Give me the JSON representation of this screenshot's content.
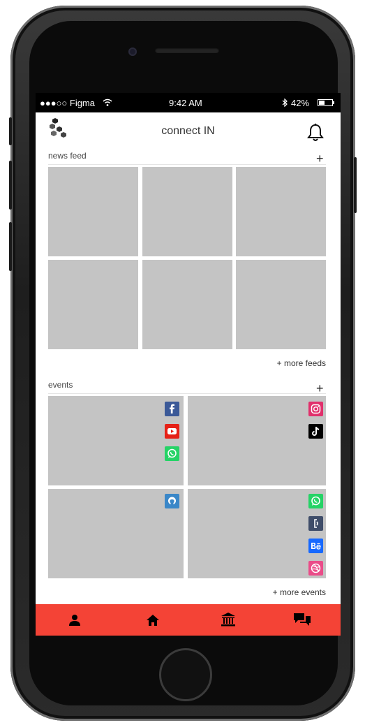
{
  "status_bar": {
    "carrier": "●●●○○ Figma",
    "time": "9:42 AM",
    "battery": "42%",
    "battery_level": 0.42
  },
  "header": {
    "title": "connect IN",
    "logo_icon": "hexagon-cluster-logo",
    "bell_icon": "bell-icon"
  },
  "news_feed": {
    "label": "news feed",
    "add_symbol": "+",
    "more_link": "+  more feeds",
    "tile_count": 6
  },
  "events": {
    "label": "events",
    "add_symbol": "+",
    "more_link": "+  more events",
    "cards": [
      {
        "icons": [
          "facebook-icon",
          "youtube-icon",
          "whatsapp-icon"
        ]
      },
      {
        "icons": [
          "instagram-icon",
          "tiktok-icon"
        ]
      },
      {
        "icons": [
          "github-icon"
        ]
      },
      {
        "icons": [
          "whatsapp-icon",
          "google-scholar-icon",
          "behance-icon",
          "dribbble-icon"
        ]
      }
    ]
  },
  "tab_bar": {
    "items": [
      "profile-icon",
      "home-icon",
      "institution-icon",
      "chat-icon"
    ]
  },
  "colors": {
    "tab_bar": "#f44336",
    "tile": "#c4c4c4",
    "facebook": "#3b5998",
    "youtube": "#e62117",
    "whatsapp": "#25d366",
    "instagram": "#e1306c",
    "tiktok": "#000000",
    "github": "#3a87c8",
    "scholar": "#3f4d69",
    "behance": "#1769ff",
    "dribbble": "#ea4c89"
  }
}
